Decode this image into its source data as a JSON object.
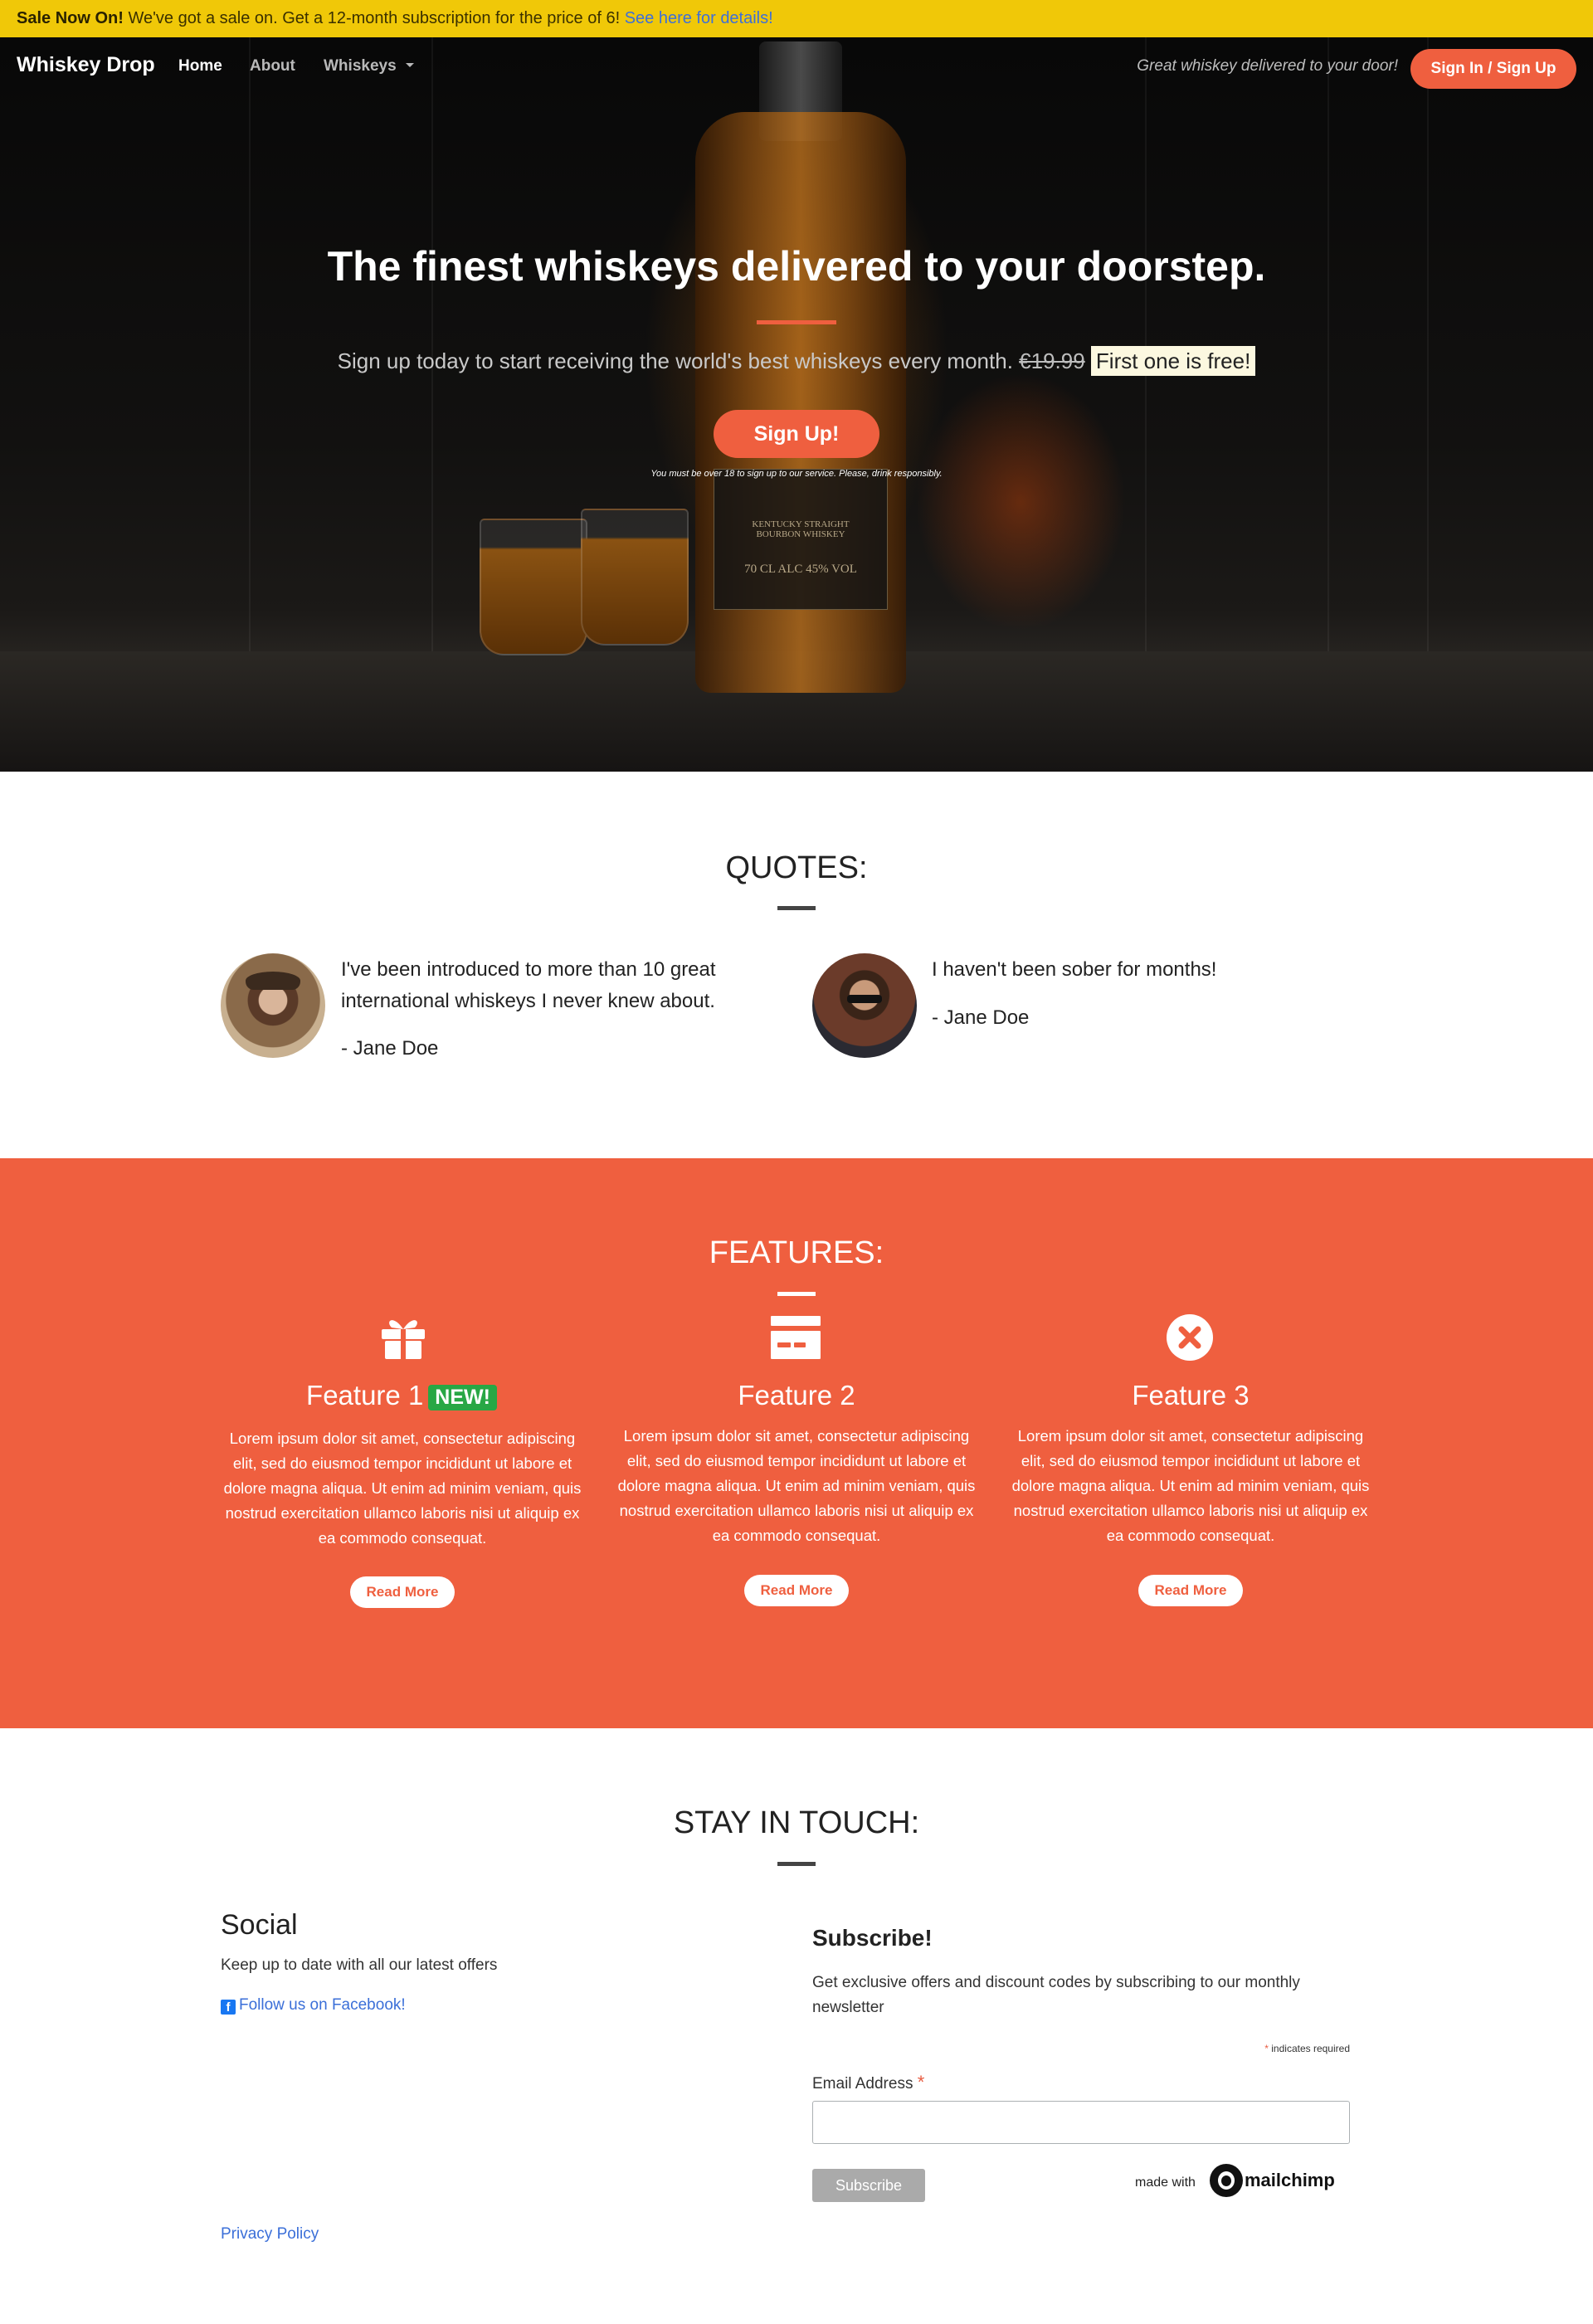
{
  "sale_bar": {
    "bold": "Sale Now On!",
    "text": " We've got a sale on. Get a 12-month subscription for the price of 6! ",
    "link": "See here for details!"
  },
  "navbar": {
    "brand": "Whiskey Drop",
    "links": [
      "Home",
      "About",
      "Whiskeys"
    ],
    "tagline": "Great whiskey delivered to your door!",
    "signin": "Sign In / Sign Up"
  },
  "hero": {
    "title": "The finest whiskeys delivered to your doorstep.",
    "subtitle": "Sign up today to start receiving the world's best whiskeys every month.",
    "old_price": "€19.99",
    "highlight": "First one is free!",
    "button": "Sign Up!",
    "disclaimer": "You must be over 18 to sign up to our service. Please, drink responsibly.",
    "bottle_label": [
      "KENTUCKY STRAIGHT",
      "BOURBON WHISKEY",
      "70 CL    ALC 45% VOL"
    ]
  },
  "quotes": {
    "title": "QUOTES:",
    "items": [
      {
        "text": "I've been introduced to more than 10 great international whiskeys I never knew about.",
        "author": "- Jane Doe"
      },
      {
        "text": "I haven't been sober for months!",
        "author": "- Jane Doe"
      }
    ]
  },
  "features": {
    "title": "FEATURES:",
    "badge": "NEW!",
    "items": [
      {
        "title": "Feature 1",
        "icon": "gift-icon",
        "body": "Lorem ipsum dolor sit amet, consectetur adipiscing elit, sed do eiusmod tempor incididunt ut labore et dolore magna aliqua. Ut enim ad minim veniam, quis nostrud exercitation ullamco laboris nisi ut aliquip ex ea commodo consequat.",
        "button": "Read More"
      },
      {
        "title": "Feature 2",
        "icon": "credit-card-icon",
        "body": "Lorem ipsum dolor sit amet, consectetur adipiscing elit, sed do eiusmod tempor incididunt ut labore et dolore magna aliqua. Ut enim ad minim veniam, quis nostrud exercitation ullamco laboris nisi ut aliquip ex ea commodo consequat.",
        "button": "Read More"
      },
      {
        "title": "Feature 3",
        "icon": "close-circle-icon",
        "body": "Lorem ipsum dolor sit amet, consectetur adipiscing elit, sed do eiusmod tempor incididunt ut labore et dolore magna aliqua. Ut enim ad minim veniam, quis nostrud exercitation ullamco laboris nisi ut aliquip ex ea commodo consequat.",
        "button": "Read More"
      }
    ]
  },
  "contact": {
    "title": "STAY IN TOUCH:",
    "social_title": "Social",
    "social_text": "Keep up to date with all our latest offers",
    "facebook_link": "Follow us on Facebook!",
    "subscribe_title": "Subscribe!",
    "subscribe_text": "Get exclusive offers and discount codes by subscribing to our monthly newsletter",
    "required_note": "indicates required",
    "email_label": "Email Address",
    "email_value": "",
    "subscribe_button": "Subscribe",
    "made_with": "made with",
    "mailchimp": "mailchimp",
    "privacy": "Privacy Policy"
  },
  "colors": {
    "accent": "#ef5f3f",
    "sale_bar": "#f0c808",
    "badge": "#28a745",
    "link": "#3b6fd8"
  }
}
